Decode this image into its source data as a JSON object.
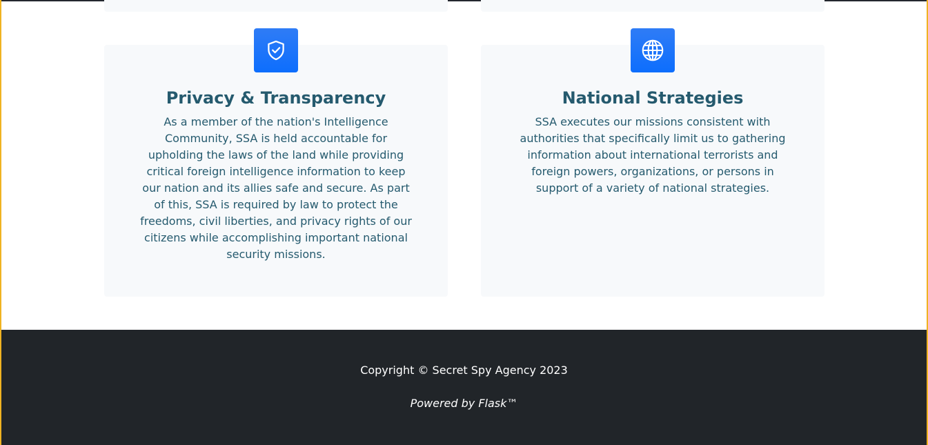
{
  "features": [
    {
      "icon": "shield-check-icon",
      "title": "Privacy & Transparency",
      "text": "As a member of the nation's Intelligence Community, SSA is held accountable for upholding the laws of the land while providing critical foreign intelligence information to keep our nation and its allies safe and secure. As part of this, SSA is required by law to protect the freedoms, civil liberties, and privacy rights of our citizens while accomplishing important national security missions."
    },
    {
      "icon": "globe-icon",
      "title": "National Strategies",
      "text": "SSA executes our missions consistent with authorities that specifically limit us to gathering information about international terrorists and foreign powers, organizations, or persons in support of a variety of national strategies."
    }
  ],
  "footer": {
    "copyright": "Copyright © Secret Spy Agency 2023",
    "powered_by": "Powered by Flask™"
  },
  "colors": {
    "accent": "#0d6efd",
    "heading": "#255a6e",
    "card_bg": "#f7f9fb",
    "footer_bg": "#212529",
    "frame_border": "#f0b321"
  }
}
